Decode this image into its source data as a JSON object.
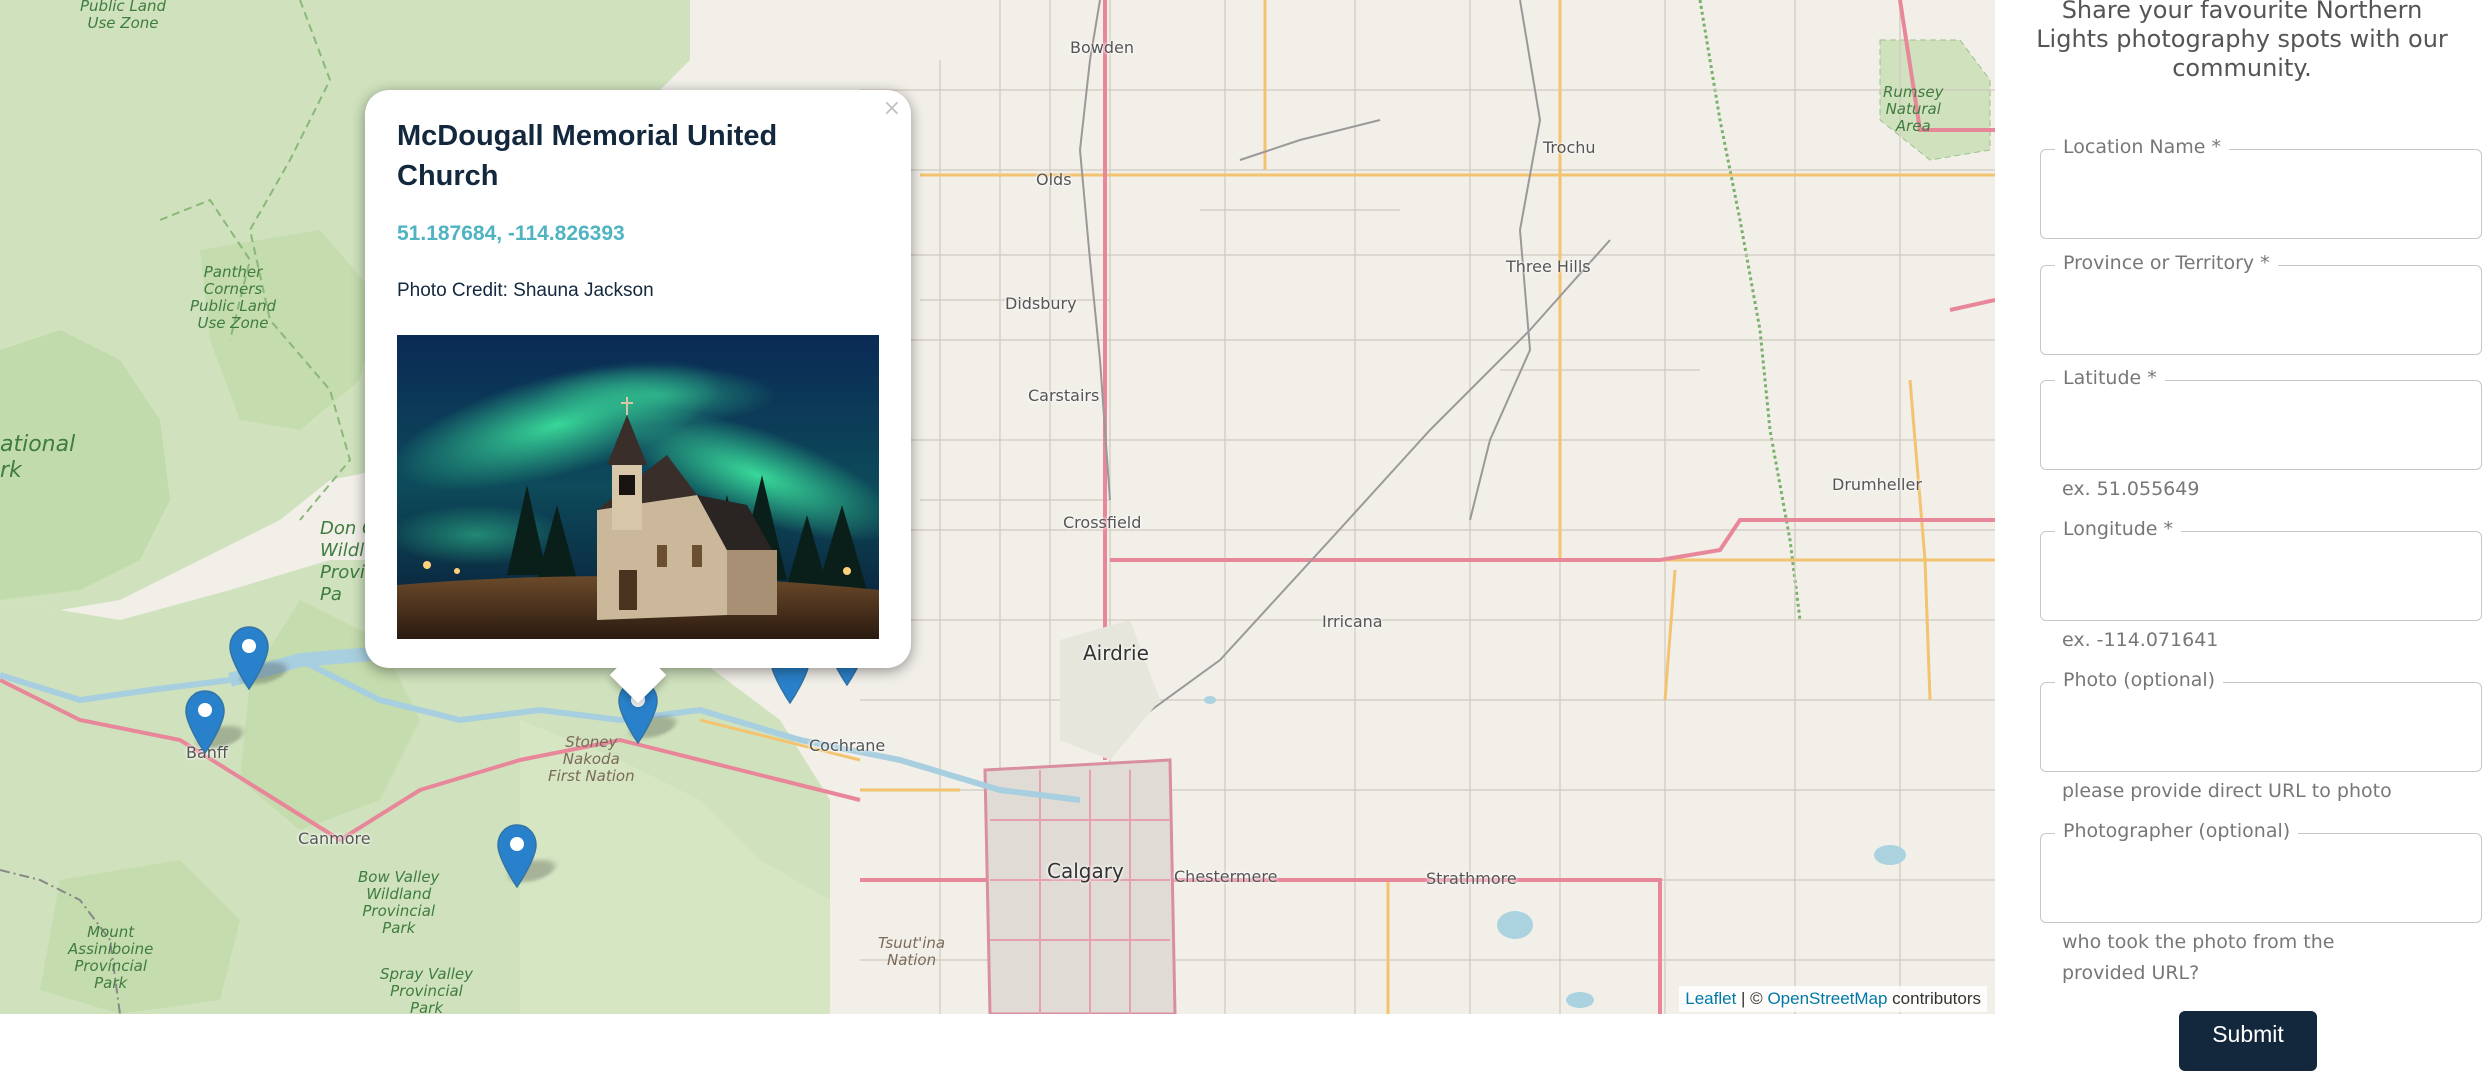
{
  "map": {
    "town_labels": {
      "bowden": "Bowden",
      "olds": "Olds",
      "trochu": "Trochu",
      "three_hills": "Three Hills",
      "didsbury": "Didsbury",
      "carstairs": "Carstairs",
      "crossfield": "Crossfield",
      "drumheller": "Drumheller",
      "irricana": "Irricana",
      "airdrie": "Airdrie",
      "cochrane": "Cochrane",
      "banff": "Banff",
      "canmore": "Canmore",
      "calgary": "Calgary",
      "chestermere": "Chestermere",
      "strathmore": "Strathmore"
    },
    "park_labels": {
      "public_land": "Public Land\nUse Zone",
      "panther_corners": "Panther\nCorners\nPublic Land\nUse Zone",
      "national_park": "ational\nrk",
      "don_getty": "Don C\nWildl\nProvi\nPa",
      "rumsey": "Rumsey\nNatural\nArea",
      "bow_valley": "Bow Valley\nWildland\nProvincial\nPark",
      "mount_assiniboine": "Mount\nAssiniboine\nProvincial\nPark",
      "spray_valley": "Spray Valley\nProvincial\nPark"
    },
    "reserve_labels": {
      "stoney_nakoda": "Stoney\nNakoda\nFirst Nation",
      "tsuutina": "Tsuut'ina\nNation"
    },
    "marker_color": "#2a81cb",
    "attribution": {
      "leaflet": "Leaflet",
      "separator": " | © ",
      "osm": "OpenStreetMap",
      "suffix": " contributors"
    }
  },
  "popup": {
    "close": "×",
    "title": "McDougall Memorial United Church",
    "coordinates": "51.187684, -114.826393",
    "credit": "Photo Credit: Shauna Jackson"
  },
  "form": {
    "intro": "Share your favourite Northern Lights photography spots with our community.",
    "fields": {
      "location_name": {
        "label": "Location Name *",
        "value": ""
      },
      "province": {
        "label": "Province or Territory *",
        "value": ""
      },
      "latitude": {
        "label": "Latitude *",
        "value": "",
        "hint": "ex. 51.055649"
      },
      "longitude": {
        "label": "Longitude *",
        "value": "",
        "hint": "ex. -114.071641"
      },
      "photo": {
        "label": "Photo (optional)",
        "value": "",
        "hint": "please provide direct URL to photo"
      },
      "photographer": {
        "label": "Photographer (optional)",
        "value": "",
        "hint": "who took the photo from the provided URL?"
      }
    },
    "submit_label": "Submit",
    "submit_color": "#14283d"
  }
}
